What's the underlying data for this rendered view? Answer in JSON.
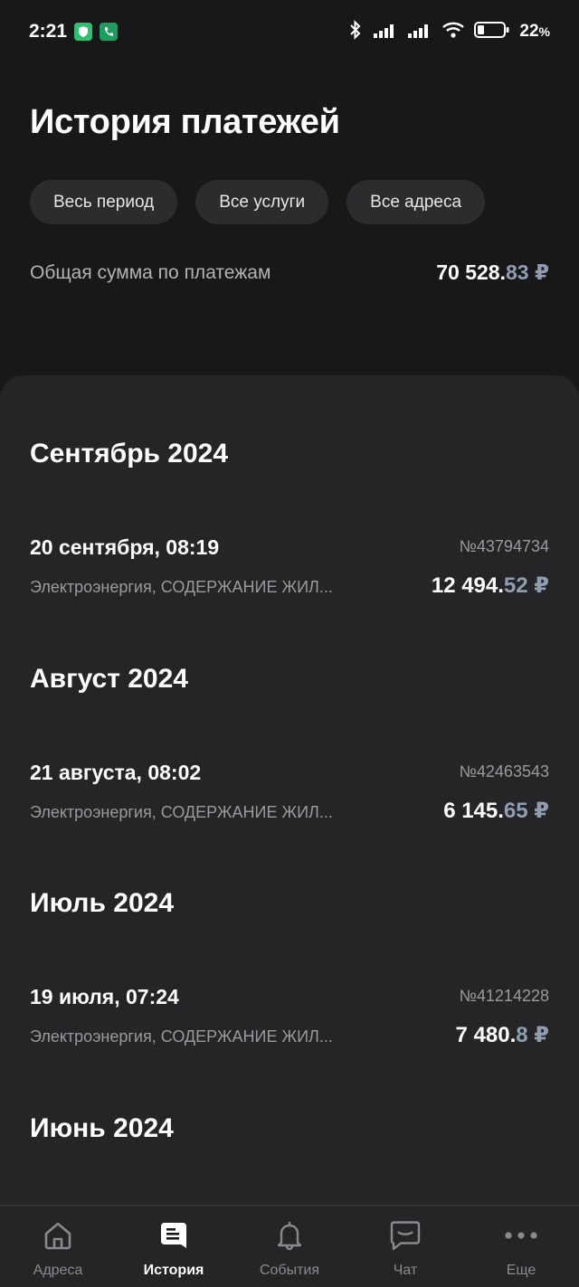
{
  "status_bar": {
    "time": "2:21",
    "battery_pct": "22",
    "battery_suffix": "%"
  },
  "header": {
    "title": "История платежей",
    "filters": [
      {
        "label": "Весь период"
      },
      {
        "label": "Все услуги"
      },
      {
        "label": "Все адреса"
      }
    ],
    "total_label": "Общая сумма по платежам",
    "total_rub": "70 528.",
    "total_kop": "83",
    "currency": "₽"
  },
  "months": [
    {
      "title": "Сентябрь 2024",
      "payments": [
        {
          "date": "20 сентября, 08:19",
          "number": "№43794734",
          "services": "Электроэнергия, СОДЕРЖАНИЕ ЖИЛ...",
          "rub": "12 494.",
          "kop": "52"
        }
      ]
    },
    {
      "title": "Август 2024",
      "payments": [
        {
          "date": "21 августа, 08:02",
          "number": "№42463543",
          "services": "Электроэнергия, СОДЕРЖАНИЕ ЖИЛ...",
          "rub": "6 145.",
          "kop": "65"
        }
      ]
    },
    {
      "title": "Июль 2024",
      "payments": [
        {
          "date": "19 июля, 07:24",
          "number": "№41214228",
          "services": "Электроэнергия, СОДЕРЖАНИЕ ЖИЛ...",
          "rub": "7 480.",
          "kop": "8"
        }
      ]
    },
    {
      "title": "Июнь 2024",
      "payments": []
    }
  ],
  "bottom_nav": [
    {
      "label": "Адреса",
      "icon": "home-icon"
    },
    {
      "label": "История",
      "icon": "history-icon",
      "active": true
    },
    {
      "label": "События",
      "icon": "bell-icon"
    },
    {
      "label": "Чат",
      "icon": "chat-icon"
    },
    {
      "label": "Еще",
      "icon": "more-icon"
    }
  ],
  "colors": {
    "background": "#181818",
    "sheet": "#252527",
    "chip": "#2c2c2e",
    "kopecks": "#8f9db2",
    "secondary_text": "#9a9a9e"
  }
}
